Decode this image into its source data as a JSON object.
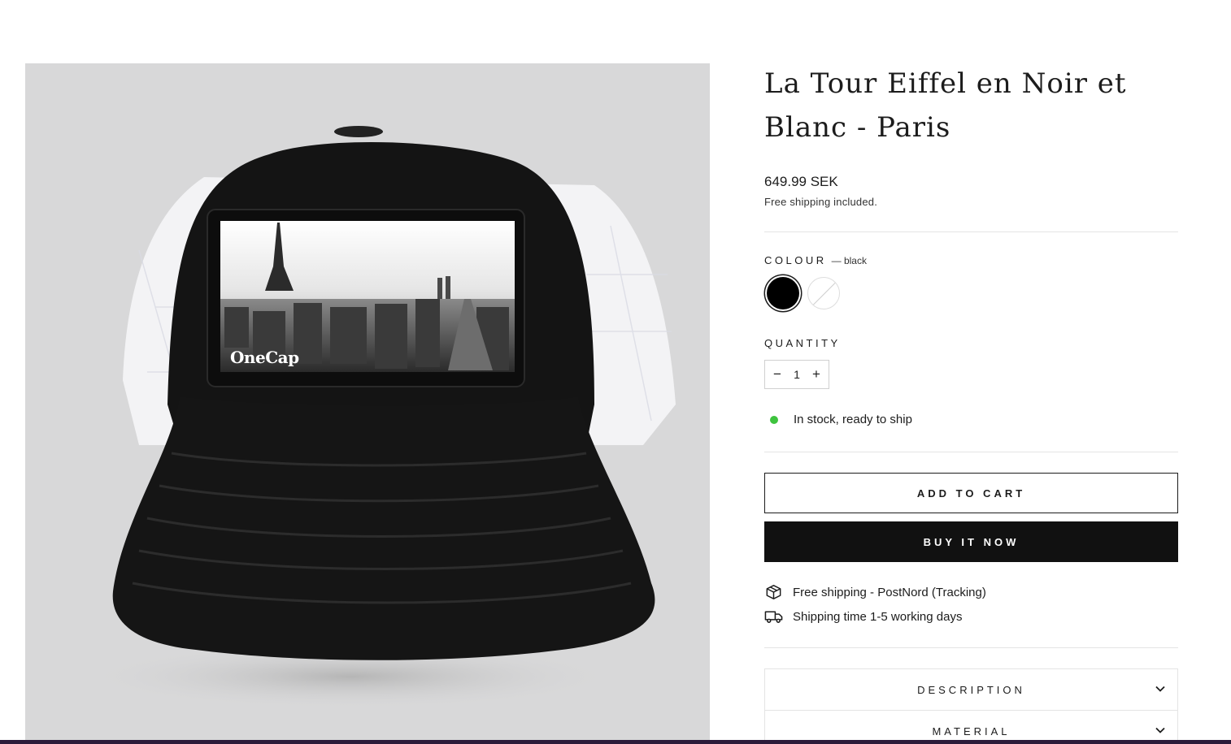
{
  "product": {
    "title": "La Tour Eiffel en Noir et Blanc - Paris",
    "price": "649.99 SEK",
    "shipping_note": "Free shipping included.",
    "image_alt_brand": "OneCap"
  },
  "colour": {
    "label": "COLOUR",
    "selected": "— black",
    "options": [
      "black",
      "white"
    ]
  },
  "quantity": {
    "label": "QUANTITY",
    "value": "1",
    "minus": "−",
    "plus": "+"
  },
  "stock": {
    "text": "In stock, ready to ship",
    "status_color": "#3ec33e"
  },
  "actions": {
    "add_to_cart": "ADD TO CART",
    "buy_now": "BUY IT NOW"
  },
  "features": [
    {
      "icon": "package-icon",
      "text": "Free shipping - PostNord (Tracking)"
    },
    {
      "icon": "truck-icon",
      "text": "Shipping time 1-5 working days"
    }
  ],
  "accordions": [
    {
      "label": "DESCRIPTION"
    },
    {
      "label": "MATERIAL"
    }
  ]
}
